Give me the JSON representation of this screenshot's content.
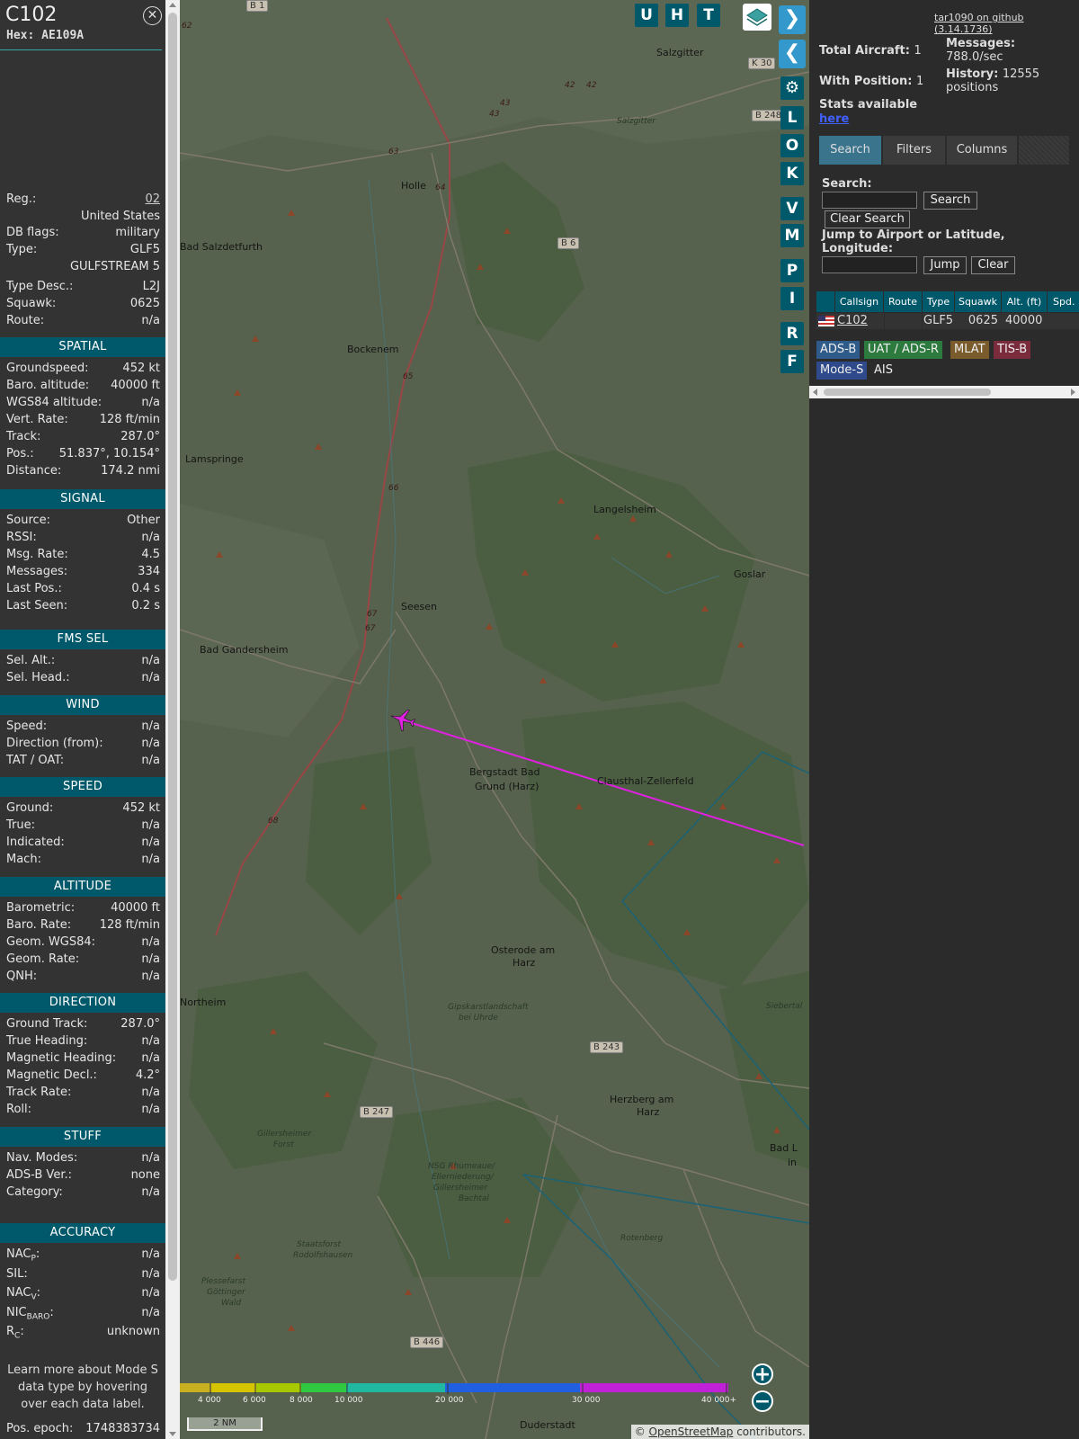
{
  "info": {
    "callsign": "C102",
    "hex_label": "Hex:",
    "hex": "AE109A",
    "close_glyph": "✕",
    "reg_label": "Reg.:",
    "reg": "02",
    "country": "United States",
    "dbflags_label": "DB flags:",
    "dbflags": "military",
    "type_label": "Type:",
    "type": "GLF5",
    "type_name": "GULFSTREAM 5",
    "typedesc_label": "Type Desc.:",
    "typedesc": "L2J",
    "squawk_label": "Squawk:",
    "squawk": "0625",
    "route_label": "Route:",
    "route": "n/a",
    "sections": {
      "spatial": "SPATIAL",
      "signal": "SIGNAL",
      "fmssel": "FMS SEL",
      "wind": "WIND",
      "speed": "SPEED",
      "altitude": "ALTITUDE",
      "direction": "DIRECTION",
      "stuff": "STUFF",
      "accuracy": "ACCURACY"
    },
    "spatial": [
      {
        "label": "Groundspeed:",
        "value": "452 kt"
      },
      {
        "label": "Baro. altitude:",
        "value": "40000 ft"
      },
      {
        "label": "WGS84 altitude:",
        "value": "n/a"
      },
      {
        "label": "Vert. Rate:",
        "value": "128 ft/min"
      },
      {
        "label": "Track:",
        "value": "287.0°"
      },
      {
        "label": "Pos.:",
        "value": "51.837°, 10.154°"
      },
      {
        "label": "Distance:",
        "value": "174.2 nmi"
      }
    ],
    "signal": [
      {
        "label": "Source:",
        "value": "Other"
      },
      {
        "label": "RSSI:",
        "value": "n/a"
      },
      {
        "label": "Msg. Rate:",
        "value": "4.5"
      },
      {
        "label": "Messages:",
        "value": "334"
      },
      {
        "label": "Last Pos.:",
        "value": "0.4 s"
      },
      {
        "label": "Last Seen:",
        "value": "0.2 s"
      }
    ],
    "fmssel": [
      {
        "label": "Sel. Alt.:",
        "value": "n/a"
      },
      {
        "label": "Sel. Head.:",
        "value": "n/a"
      }
    ],
    "wind": [
      {
        "label": "Speed:",
        "value": "n/a"
      },
      {
        "label": "Direction (from):",
        "value": "n/a"
      },
      {
        "label": "TAT / OAT:",
        "value": "n/a"
      }
    ],
    "speed": [
      {
        "label": "Ground:",
        "value": "452 kt"
      },
      {
        "label": "True:",
        "value": "n/a"
      },
      {
        "label": "Indicated:",
        "value": "n/a"
      },
      {
        "label": "Mach:",
        "value": "n/a"
      }
    ],
    "altitude": [
      {
        "label": "Barometric:",
        "value": "40000 ft"
      },
      {
        "label": "Baro. Rate:",
        "value": "128 ft/min"
      },
      {
        "label": "Geom. WGS84:",
        "value": "n/a"
      },
      {
        "label": "Geom. Rate:",
        "value": "n/a"
      },
      {
        "label": "QNH:",
        "value": "n/a"
      }
    ],
    "direction": [
      {
        "label": "Ground Track:",
        "value": "287.0°"
      },
      {
        "label": "True Heading:",
        "value": "n/a"
      },
      {
        "label": "Magnetic Heading:",
        "value": "n/a"
      },
      {
        "label": "Magnetic Decl.:",
        "value": "4.2°"
      },
      {
        "label": "Track Rate:",
        "value": "n/a"
      },
      {
        "label": "Roll:",
        "value": "n/a"
      }
    ],
    "stuff": [
      {
        "label": "Nav. Modes:",
        "value": "n/a"
      },
      {
        "label": "ADS-B Ver.:",
        "value": "none"
      },
      {
        "label": "Category:",
        "value": "n/a"
      }
    ],
    "accuracy": [
      {
        "label": "NAC",
        "sub": "P",
        "suffix": ":",
        "value": "n/a"
      },
      {
        "label": "SIL:",
        "sub": "",
        "suffix": "",
        "value": "n/a"
      },
      {
        "label": "NAC",
        "sub": "V",
        "suffix": ":",
        "value": "n/a"
      },
      {
        "label": "NIC",
        "sub": "BARO",
        "suffix": ":",
        "value": "n/a"
      },
      {
        "label": "R",
        "sub": "C",
        "suffix": ":",
        "value": "unknown"
      }
    ],
    "learn": "Learn more about Mode S data type by hovering over each data label.",
    "epoch_label": "Pos. epoch:",
    "epoch": "1748383734"
  },
  "map": {
    "buttons_top": [
      "U",
      "H",
      "T"
    ],
    "buttons_side": [
      "L",
      "O",
      "K",
      "V",
      "M",
      "P",
      "I",
      "R",
      "F"
    ],
    "nav_next": "❯",
    "nav_prev": "❮",
    "toggle": "◂▸",
    "gear": "⚙",
    "zoom_in": "+",
    "zoom_out": "−",
    "places": [
      "Salzgitter",
      "Holle",
      "Bad Salzdetfurth",
      "Bockenem",
      "Lamspringe",
      "Langelsheim",
      "Goslar",
      "Seesen",
      "Bad Gandersheim",
      "Bergstadt Bad",
      "Grund (Harz)",
      "Clausthal-Zellerfeld",
      "Osterode am",
      "Harz",
      "Northeim",
      "Herzberg am",
      "Harz",
      "Duderstadt",
      "Bad L",
      "in"
    ],
    "small_places": [
      "Salzgitter",
      "Gipskarstlandschaft",
      "bei Uhrde",
      "Gillersheimer",
      "Forst",
      "NSG Rhumeaue/",
      "Ellerniederung/",
      "Gillersheimer",
      "Bachtal",
      "Staatsforst",
      "Rodolfshausen",
      "Plessefarst",
      "Göttinger",
      "Wald",
      "Rotenberg",
      "Siebertal"
    ],
    "roads": [
      "B 1",
      "K 30",
      "B 248",
      "B 6",
      "B 243",
      "B 247",
      "B 446"
    ],
    "road_numbers": [
      "62",
      "42",
      "42",
      "43",
      "43",
      "63",
      "64",
      "65",
      "66",
      "67",
      "67",
      "68"
    ],
    "color_ticks": [
      "4 000",
      "6 000",
      "8 000",
      "10 000",
      "20 000",
      "30 000",
      "40 000+"
    ],
    "scale": "2 NM",
    "attribution_symbol": "©",
    "attribution_link": "OpenStreetMap",
    "attribution_rest": "contributors."
  },
  "side": {
    "github": "tar1090 on github (3.14.1736)",
    "total_label": "Total Aircraft:",
    "total": "1",
    "messages_label": "Messages:",
    "messages": "788.0/sec",
    "withpos_label": "With Position:",
    "withpos": "1",
    "history_label": "History:",
    "history": "12555",
    "history_unit": "positions",
    "stats_label": "Stats available",
    "stats_link": "here",
    "tabs": [
      "Search",
      "Filters",
      "Columns"
    ],
    "search_label": "Search:",
    "search_button": "Search",
    "clear_search": "Clear Search",
    "jump_label": "Jump to Airport or Latitude, Longitude:",
    "jump_button": "Jump",
    "clear_button": "Clear",
    "columns": [
      "Callsign",
      "Route",
      "Type",
      "Squawk",
      "Alt. (ft)",
      "Spd."
    ],
    "row": {
      "callsign": "C102",
      "route": "",
      "type": "GLF5",
      "squawk": "0625",
      "alt": "40000"
    },
    "badges": [
      "ADS-B",
      "UAT / ADS-R",
      "MLAT",
      "TIS-B",
      "Mode-S",
      "AIS"
    ]
  }
}
